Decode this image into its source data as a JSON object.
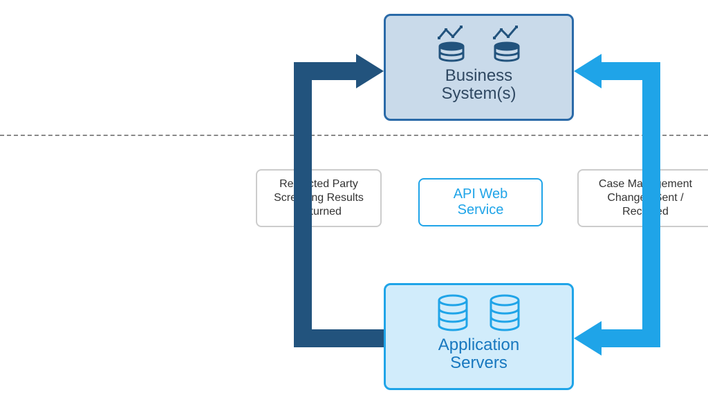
{
  "nodes": {
    "business": {
      "title_l1": "Business",
      "title_l2": "System(s)"
    },
    "app": {
      "title_l1": "Application",
      "title_l2": "Servers"
    },
    "api": {
      "title_l1": "API Web",
      "title_l2": "Service"
    }
  },
  "labels": {
    "left": "Restricted Party Screening Results Returned",
    "right": "Case Management Changes Sent / Received"
  },
  "colors": {
    "dark": "#22537d",
    "light": "#1fa4e8"
  },
  "icons": {
    "db_chart": "database-chart-icon",
    "db_plain": "database-icon"
  }
}
